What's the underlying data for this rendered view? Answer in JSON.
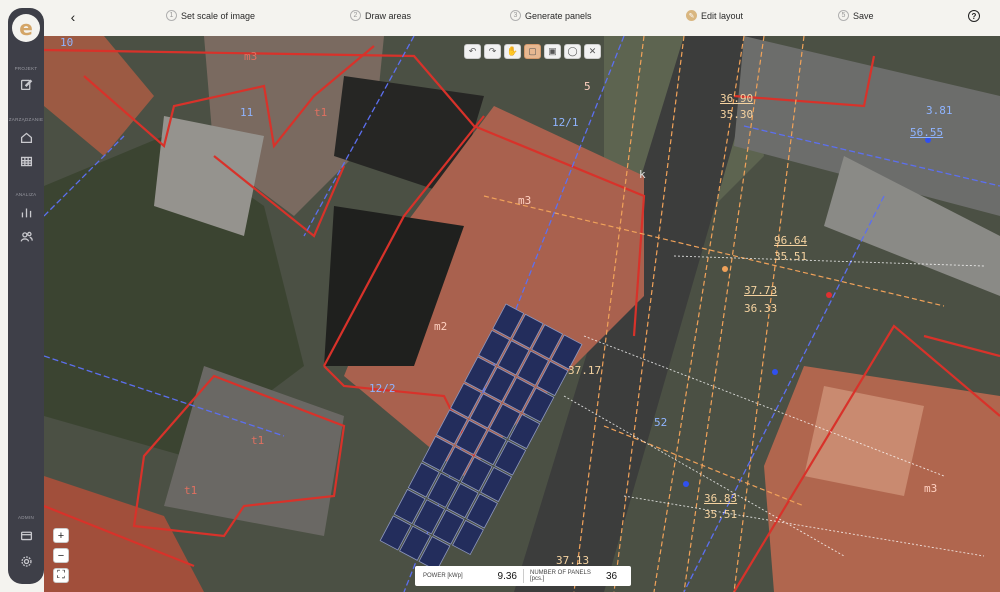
{
  "sidebar": {
    "logo_letter": "e",
    "sections": {
      "project": "PROJEKT",
      "catalog": "ZARZĄDZANIE",
      "analysis": "ANALIZA",
      "admin": "ADMIN"
    },
    "icons": [
      "edit-icon",
      "home-icon",
      "grid-icon",
      "chart-icon",
      "users-icon",
      "card-icon",
      "settings-icon"
    ]
  },
  "steps": [
    {
      "num": "1",
      "label": "Set scale of image"
    },
    {
      "num": "2",
      "label": "Draw areas"
    },
    {
      "num": "3",
      "label": "Generate panels"
    },
    {
      "num": "4",
      "label": "Edit layout"
    },
    {
      "num": "5",
      "label": "Save"
    }
  ],
  "active_step": "4",
  "help_label": "?",
  "toolbar": [
    "undo-icon",
    "redo-icon",
    "hand-icon",
    "select-icon",
    "panel-icon",
    "circle-icon",
    "close-icon"
  ],
  "zoom": {
    "in": "+",
    "out": "−",
    "fit": "⛶"
  },
  "status": {
    "power_label": "POWER [kWp]",
    "power_value": "9.36",
    "panels_label": "NUMBER OF PANELS [pcs.]",
    "panels_value": "36"
  },
  "map_labels": [
    "m3",
    "11",
    "t1",
    "12/1",
    "k",
    "m3",
    "m2",
    "12/2",
    "t1",
    "t1",
    "52",
    "m3",
    "5",
    "10",
    "36.90",
    "35.30",
    "96.64",
    "35.51",
    "37.73",
    "36.33",
    "36.83",
    "35.51",
    "37.17",
    "56.55",
    "3.81",
    "37.13"
  ],
  "colors": {
    "accent": "#d9b680",
    "sidebar": "#3e3f48",
    "parcel_red": "#d8322a",
    "utility_blue": "#5c6ff0",
    "utility_orange": "#f0a25a",
    "panel": "#1f2a5c"
  }
}
